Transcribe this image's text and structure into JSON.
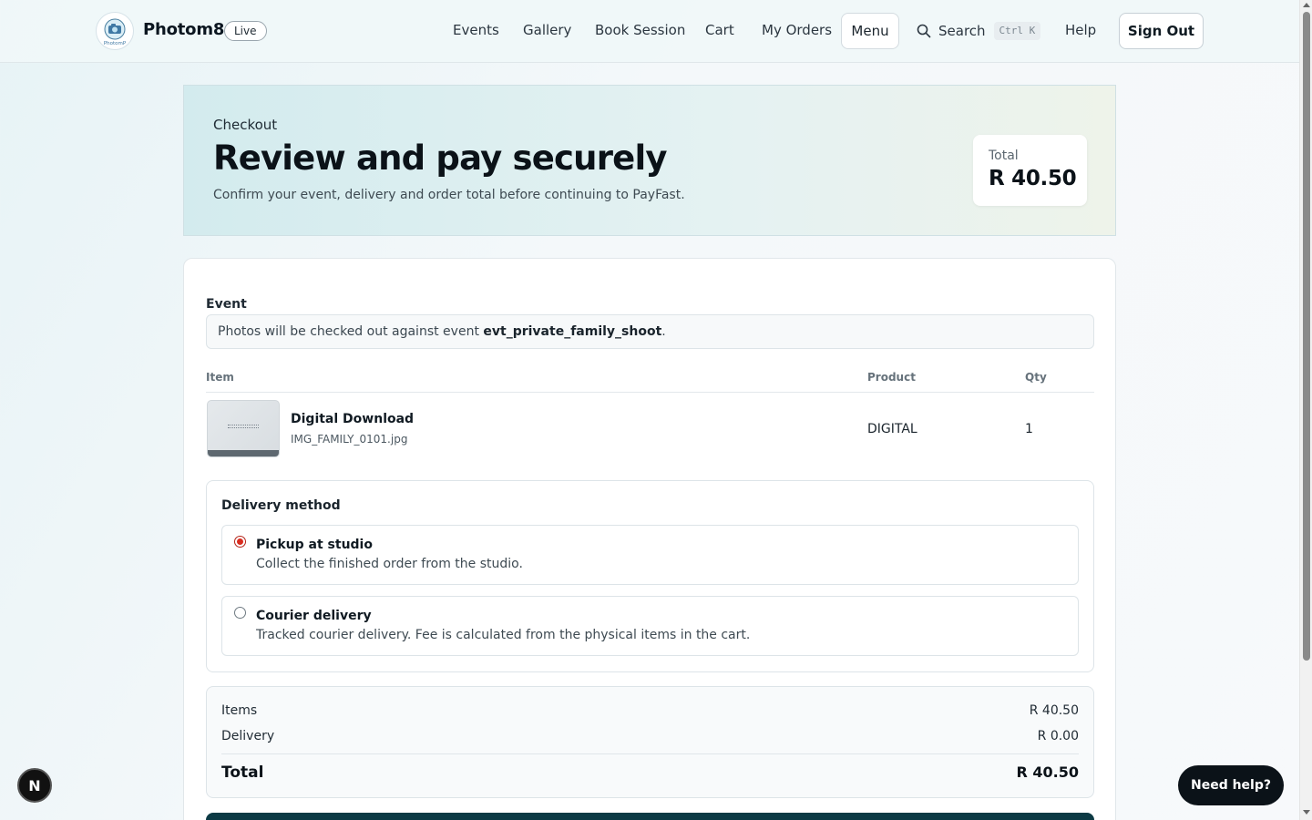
{
  "header": {
    "brand": "Photom8",
    "logo_caption": "PhotomP",
    "live_badge": "Live",
    "nav": [
      "Events",
      "Gallery",
      "Book Session",
      "Cart",
      "My Orders"
    ],
    "menu_label": "Menu",
    "search_label": "Search",
    "search_shortcut": "Ctrl K",
    "help_label": "Help",
    "sign_out_label": "Sign Out"
  },
  "hero": {
    "eyebrow": "Checkout",
    "title": "Review and pay securely",
    "subtitle": "Confirm your event, delivery and order total before continuing to PayFast.",
    "total_label": "Total",
    "total_value": "R 40.50"
  },
  "event": {
    "label": "Event",
    "text_prefix": "Photos will be checked out against event ",
    "event_id": "evt_private_family_shoot",
    "text_suffix": "."
  },
  "items_table": {
    "columns": [
      "Item",
      "Product",
      "Qty"
    ],
    "rows": [
      {
        "title": "Digital Download",
        "file": "IMG_FAMILY_0101.jpg",
        "product": "DIGITAL",
        "qty": "1"
      }
    ]
  },
  "delivery": {
    "title": "Delivery method",
    "options": [
      {
        "title": "Pickup at studio",
        "description": "Collect the finished order from the studio.",
        "selected": true
      },
      {
        "title": "Courier delivery",
        "description": "Tracked courier delivery. Fee is calculated from the physical items in the cart.",
        "selected": false
      }
    ]
  },
  "summary": {
    "items_label": "Items",
    "items_value": "R 40.50",
    "delivery_label": "Delivery",
    "delivery_value": "R 0.00",
    "total_label": "Total",
    "total_value": "R 40.50"
  },
  "floating": {
    "dev_badge": "N",
    "need_help": "Need help?"
  },
  "colors": {
    "accent_dark": "#0c3a44",
    "radio_selected": "#d92d20",
    "help_button": "#0b1218"
  }
}
